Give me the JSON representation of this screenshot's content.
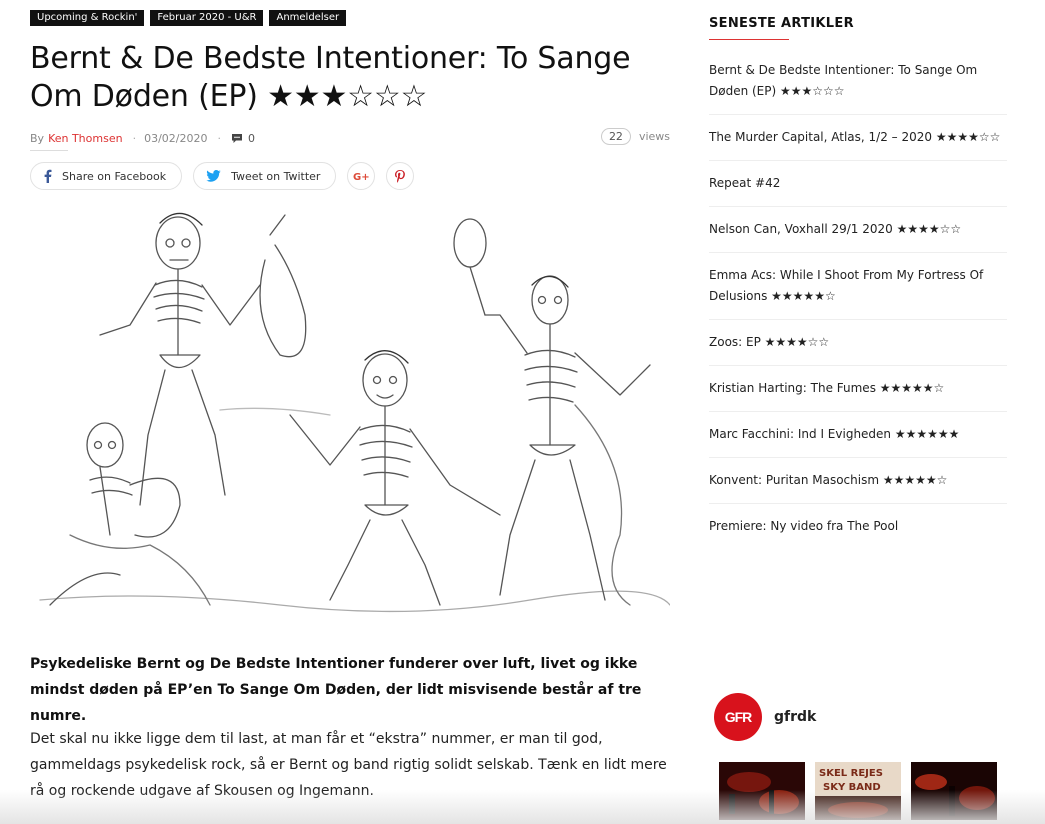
{
  "categories": [
    "Upcoming & Rockin'",
    "Februar 2020 - U&R",
    "Anmeldelser"
  ],
  "article": {
    "title": "Bernt & De Bedste Intentioner: To Sange Om Døden (EP) ★★★☆☆☆",
    "by_label": "By",
    "author": "Ken Thomsen",
    "date": "03/02/2020",
    "comments": "0",
    "views_count": "22",
    "views_label": "views",
    "lead": "Psykedeliske Bernt og De Bedste Intentioner funderer over luft, livet og ikke mindst døden på EP’en To Sange Om Døden, der lidt misvisende består af tre numre.",
    "paragraph": "Det skal nu ikke ligge dem til last, at man får et “ekstra” nummer, er man til god, gammeldags psykedelisk rock, så er Bernt og band rigtig solidt selskab. Tænk en lidt mere rå og rockende udgave af Skousen og Ingemann."
  },
  "share": {
    "facebook": "Share on Facebook",
    "twitter": "Tweet on Twitter"
  },
  "colors": {
    "accent": "#d33333",
    "facebook": "#3b5998",
    "twitter": "#1da1f2",
    "brand": "#d8121c"
  },
  "sidebar": {
    "heading": "SENESTE ARTIKLER",
    "items": [
      "Bernt & De Bedste Intentioner: To Sange Om Døden (EP) ★★★☆☆☆",
      "The Murder Capital, Atlas, 1/2 – 2020 ★★★★☆☆",
      "Repeat #42",
      "Nelson Can, Voxhall 29/1 2020 ★★★★☆☆",
      "Emma Acs: While I Shoot From My Fortress Of Delusions ★★★★★☆",
      "Zoos: EP ★★★★☆☆",
      "Kristian Harting: The Fumes ★★★★★☆",
      "Marc Facchini: Ind I Evigheden ★★★★★★",
      "Konvent: Puritan Masochism ★★★★★☆",
      "Premiere: Ny video fra The Pool"
    ]
  },
  "instagram": {
    "logo_text": "GFR",
    "handle": "gfrdk",
    "thumb_texts": [
      "SKEL REJES",
      "SKY BAND"
    ]
  }
}
